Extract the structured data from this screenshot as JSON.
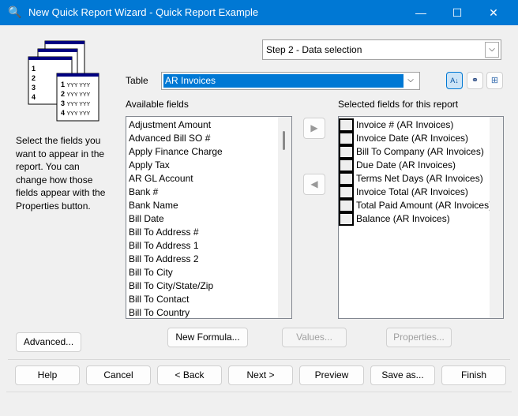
{
  "window": {
    "title": "New Quick Report Wizard - Quick Report Example",
    "minimize": "—",
    "maximize": "☐",
    "close": "✕"
  },
  "step": {
    "value": "Step 2 - Data selection"
  },
  "table": {
    "label": "Table",
    "value": "AR Invoices"
  },
  "toolbar": {
    "sort_icon": "sort-az-icon",
    "find_icon": "binoculars-icon",
    "relations_icon": "relations-icon"
  },
  "instructions": "Select the fields you want to appear in the report. You can change how those fields appear with the Properties button.",
  "available": {
    "label": "Available fields",
    "items": [
      "Adjustment Amount",
      "Advanced Bill SO #",
      "Apply Finance Charge",
      "Apply Tax",
      "AR GL Account",
      "Bank #",
      "Bank Name",
      "Bill Date",
      "Bill To Address #",
      "Bill To Address 1",
      "Bill To Address 2",
      "Bill To City",
      "Bill To City/State/Zip",
      "Bill To Contact",
      "Bill To Country"
    ]
  },
  "selected": {
    "label": "Selected fields for this report",
    "items": [
      "Invoice # (AR Invoices)",
      "Invoice Date (AR Invoices)",
      "Bill To Company (AR Invoices)",
      "Due Date (AR Invoices)",
      "Terms Net Days (AR Invoices)",
      "Invoice Total (AR Invoices)",
      "Total Paid Amount (AR Invoices)",
      "Balance (AR Invoices)"
    ]
  },
  "buttons": {
    "advanced": "Advanced...",
    "new_formula": "New Formula...",
    "values": "Values...",
    "properties": "Properties...",
    "help": "Help",
    "cancel": "Cancel",
    "back": "< Back",
    "next": "Next >",
    "preview": "Preview",
    "save_as": "Save as...",
    "finish": "Finish"
  }
}
